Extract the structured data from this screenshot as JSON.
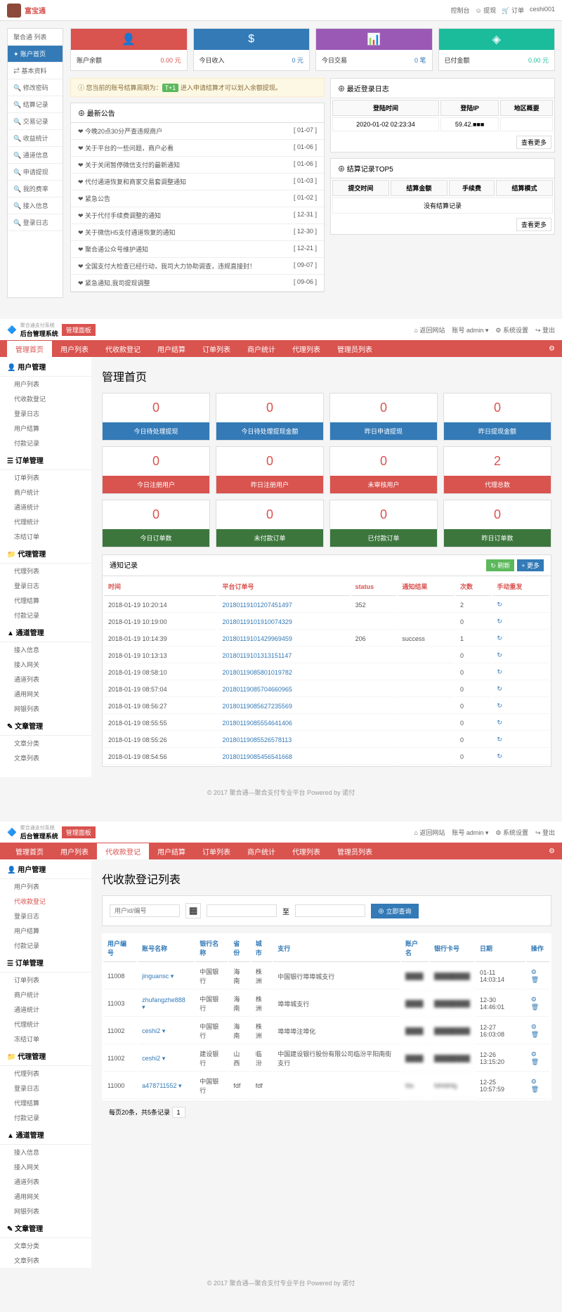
{
  "top": {
    "brand": "富宝通",
    "right": [
      "控制台",
      "☺ 提现",
      "🛒 订单",
      "ceshi001"
    ]
  },
  "sidebar1": {
    "title": "聚合通 列表",
    "items": [
      "✦ 账户首页",
      "⇄ 基本资料",
      "🔍 修改密码",
      "🔍 结算记录",
      "🔍 交易记录",
      "🔍 收益统计",
      "🔍 通道信息",
      "🔍 申请提现",
      "🔍 我的费率",
      "🔍 接入信息",
      "🔍 登录日志"
    ]
  },
  "stats1": [
    {
      "label": "账户余额",
      "val": "0.00 元",
      "cls": "red",
      "icon": "👤"
    },
    {
      "label": "今日收入",
      "val": "0 元",
      "cls": "blue",
      "icon": "$"
    },
    {
      "label": "今日交易",
      "val": "0 笔",
      "cls": "blue",
      "icon": "📊",
      "iconCls": "purple"
    },
    {
      "label": "已付金额",
      "val": "0.00 元",
      "cls": "green",
      "icon": "◈"
    }
  ],
  "alert": {
    "pre": "您当前的账号结算周期为：",
    "badge": "T+1",
    "post": "进入申请结算才可以划入余额提现。"
  },
  "notices": {
    "title": "⊕ 最新公告",
    "items": [
      {
        "t": "❤ 今晚20点30分严查违规商户",
        "d": "[ 01-07 ]"
      },
      {
        "t": "❤ 关于平台的一些问题，商户必看",
        "d": "[ 01-06 ]"
      },
      {
        "t": "❤ 关于关闭暂停微信支付的最新通知",
        "d": "[ 01-06 ]"
      },
      {
        "t": "❤ 代付通道恢复和商家交易套调整通知",
        "d": "[ 01-03 ]"
      },
      {
        "t": "❤ 紧急公告",
        "d": "[ 01-02 ]"
      },
      {
        "t": "❤ 关于代付手续费调整的通知",
        "d": "[ 12-31 ]"
      },
      {
        "t": "❤ 关于微信H5支付通道恢复的通知",
        "d": "[ 12-30 ]"
      },
      {
        "t": "❤ 聚合通公众号维护通知",
        "d": "[ 12-21 ]"
      },
      {
        "t": "❤ 全国支付大检查已经行动，我司大力协助调查，违规直接封！",
        "d": "[ 09-07 ]"
      },
      {
        "t": "❤ 紧急通知,我司提现调整",
        "d": "[ 09-06 ]"
      }
    ]
  },
  "loginLog": {
    "title": "⊕ 最近登录日志",
    "headers": [
      "登陆时间",
      "登陆IP",
      "地区概要"
    ],
    "row": [
      "2020-01-02 02:23:34",
      "59.42.■■■",
      ""
    ],
    "more": "查看更多"
  },
  "settle": {
    "title": "⊕ 结算记录TOP5",
    "headers": [
      "提交时间",
      "结算金额",
      "手续费",
      "结算模式"
    ],
    "empty": "没有结算记录",
    "more": "查看更多"
  },
  "header2": {
    "brand1": "聚合通支付系统",
    "brand2": "后台管理系统",
    "badge": "管理面板",
    "right": [
      "⌂ 返回网站",
      "账号 admin ▾",
      "⚙ 系统设置",
      "↪ 登出"
    ]
  },
  "nav2": [
    "管理首页",
    "用户列表",
    "代收款登记",
    "用户结算",
    "订单列表",
    "商户统计",
    "代理列表",
    "管理员列表"
  ],
  "sidebar2": [
    {
      "h": "👤 用户管理",
      "items": [
        "用户列表",
        "代收款登记",
        "登录日志",
        "用户结算",
        "付款记录"
      ]
    },
    {
      "h": "☰ 订单管理",
      "items": [
        "订单列表",
        "商户统计",
        "通道统计",
        "代理统计",
        "冻结订单"
      ]
    },
    {
      "h": "📁 代理管理",
      "items": [
        "代理列表",
        "登录日志",
        "代理结算",
        "付款记录"
      ]
    },
    {
      "h": "▲ 通道管理",
      "items": [
        "接入信息",
        "接入网关",
        "通道列表",
        "通用网关",
        "网银列表"
      ]
    },
    {
      "h": "✎ 文章管理",
      "items": [
        "文章分类",
        "文章列表"
      ]
    }
  ],
  "page2": {
    "title": "管理首页",
    "row1": [
      {
        "n": "0",
        "l": "今日待处理提现",
        "c": "blue"
      },
      {
        "n": "0",
        "l": "今日待处理提现金额",
        "c": "blue"
      },
      {
        "n": "0",
        "l": "昨日申请提现",
        "c": "blue"
      },
      {
        "n": "0",
        "l": "昨日提现金额",
        "c": "blue"
      }
    ],
    "row2": [
      {
        "n": "0",
        "l": "今日注册用户",
        "c": "red"
      },
      {
        "n": "0",
        "l": "昨日注册用户",
        "c": "red"
      },
      {
        "n": "0",
        "l": "未审核用户",
        "c": "red"
      },
      {
        "n": "2",
        "l": "代理总数",
        "c": "red"
      }
    ],
    "row3": [
      {
        "n": "0",
        "l": "今日订单数",
        "c": "green"
      },
      {
        "n": "0",
        "l": "未付款订单",
        "c": "green"
      },
      {
        "n": "0",
        "l": "已付款订单",
        "c": "green"
      },
      {
        "n": "0",
        "l": "昨日订单数",
        "c": "green"
      }
    ]
  },
  "records": {
    "title": "通知记录",
    "btns": [
      "↻ 刷新",
      "+ 更多"
    ],
    "headers": [
      "时间",
      "平台订单号",
      "status",
      "通知结果",
      "次数",
      "手动重发"
    ],
    "rows": [
      [
        "2018-01-19 10:20:14",
        "20180119101207451497",
        "352",
        "",
        "2",
        "↻"
      ],
      [
        "2018-01-19 10:19:00",
        "20180119101910074329",
        "",
        "",
        "0",
        "↻"
      ],
      [
        "2018-01-19 10:14:39",
        "20180119101429969459",
        "206",
        "success",
        "1",
        "↻"
      ],
      [
        "2018-01-19 10:13:13",
        "20180119101313151147",
        "",
        "",
        "0",
        "↻"
      ],
      [
        "2018-01-19 08:58:10",
        "20180119085801019782",
        "",
        "",
        "0",
        "↻"
      ],
      [
        "2018-01-19 08:57:04",
        "20180119085704660965",
        "",
        "",
        "0",
        "↻"
      ],
      [
        "2018-01-19 08:56:27",
        "20180119085627235569",
        "",
        "",
        "0",
        "↻"
      ],
      [
        "2018-01-19 08:55:55",
        "20180119085554641406",
        "",
        "",
        "0",
        "↻"
      ],
      [
        "2018-01-19 08:55:26",
        "20180119085526578113",
        "",
        "",
        "0",
        "↻"
      ],
      [
        "2018-01-19 08:54:56",
        "20180119085456541668",
        "",
        "",
        "0",
        "↻"
      ]
    ]
  },
  "page3": {
    "title": "代收款登记列表",
    "placeholder": "用户id/编号",
    "to": "至",
    "search": "⊕ 立即查询",
    "headers": [
      "用户编号",
      "账号名称",
      "银行名称",
      "省份",
      "城市",
      "支行",
      "账户名",
      "银行卡号",
      "日期",
      "操作"
    ],
    "rows": [
      [
        "11008",
        "jinguansc ▾",
        "中国银行",
        "海南",
        "株洲",
        "中国银行埠埠城支行",
        "",
        "",
        "01-11 14:03:14",
        "⚙ 🗑"
      ],
      [
        "11003",
        "zhufangzhe888 ▾",
        "中国银行",
        "海南",
        "株洲",
        "埠埠城支行",
        "",
        "",
        "12-30 14:46:01",
        "⚙ 🗑"
      ],
      [
        "11002",
        "ceshi2 ▾",
        "中国银行",
        "海南",
        "株洲",
        "埠埠埠注埠化",
        "",
        "",
        "12-27 16:03:08",
        "⚙ 🗑"
      ],
      [
        "11002",
        "ceshi2 ▾",
        "建设银行",
        "山西",
        "临汾",
        "中国建设银行股份有限公司临汾平阳南街支行",
        "",
        "",
        "12-26 13:15:20",
        "⚙ 🗑"
      ],
      [
        "11000",
        "a478711552 ▾",
        "中国银行",
        "fdf",
        "fdf",
        "",
        "fds",
        "fdhfdhfg",
        "12-25 10:57:59",
        "⚙ 🗑"
      ]
    ],
    "pagination": "每页20条，共5条记录"
  },
  "footer": "© 2017 聚合通—聚合支付专业平台 Powered by 诺付"
}
